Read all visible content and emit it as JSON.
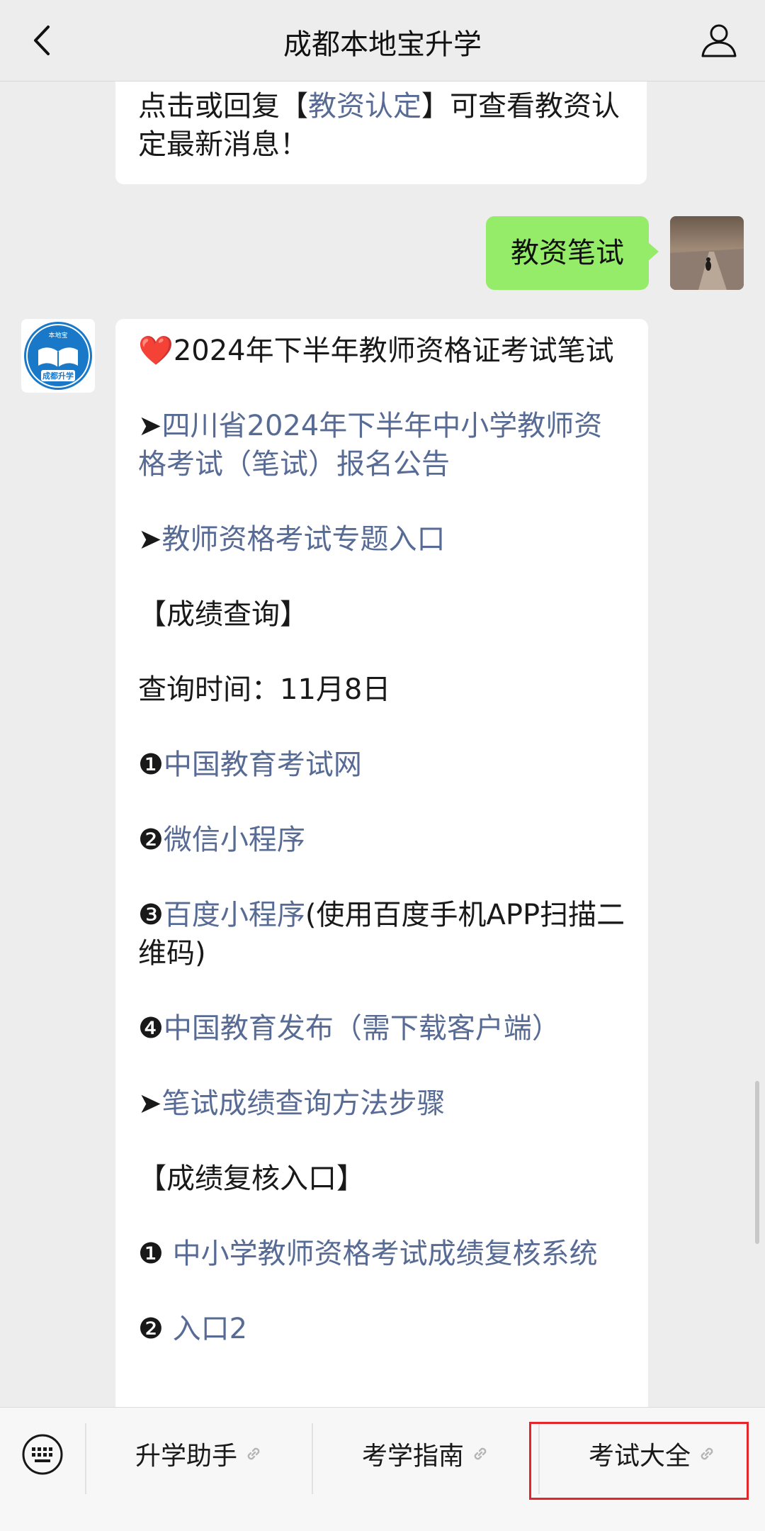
{
  "header": {
    "title": "成都本地宝升学",
    "back_icon": "chevron-left-icon",
    "profile_icon": "person-icon"
  },
  "prev_message": {
    "text_before": "点击或回复【",
    "link": "教资认定",
    "text_after": "】可查看教资认定最新消息！"
  },
  "sent_message": {
    "text": "教资笔试"
  },
  "bot": {
    "avatar_text_top": "本地宝",
    "avatar_text_bottom": "成都升学"
  },
  "main_message": {
    "heart": "❤️",
    "title": "2024年下半年教师资格证考试笔试",
    "arrow": "➤",
    "link_announcement": "四川省2024年下半年中小学教师资格考试（笔试）报名公告",
    "link_topic": "教师资格考试专题入口",
    "section_score": "【成绩查询】",
    "query_time": "查询时间：11月8日",
    "n1": "❶",
    "link_neea": "中国教育考试网",
    "n2": "❷",
    "link_wechat": "微信小程序",
    "n3": "❸",
    "link_baidu": "百度小程序",
    "baidu_note": "(使用百度手机APP扫描二维码)",
    "n4": "❹",
    "link_release": "中国教育发布（需下载客户端）",
    "link_steps": "笔试成绩查询方法步骤",
    "section_review": "【成绩复核入口】",
    "link_review_system": "中小学教师资格考试成绩复核系统",
    "link_entry2": "入口2"
  },
  "bottom_menu": {
    "keyboard_icon": "keyboard-icon",
    "items": [
      {
        "label": "升学助手",
        "icon": "link-icon"
      },
      {
        "label": "考学指南",
        "icon": "link-icon"
      },
      {
        "label": "考试大全",
        "icon": "link-icon"
      }
    ],
    "highlight_color": "#e4262b"
  },
  "colors": {
    "background": "#ededed",
    "bubble_sent": "#95ec69",
    "link": "#576b95"
  }
}
